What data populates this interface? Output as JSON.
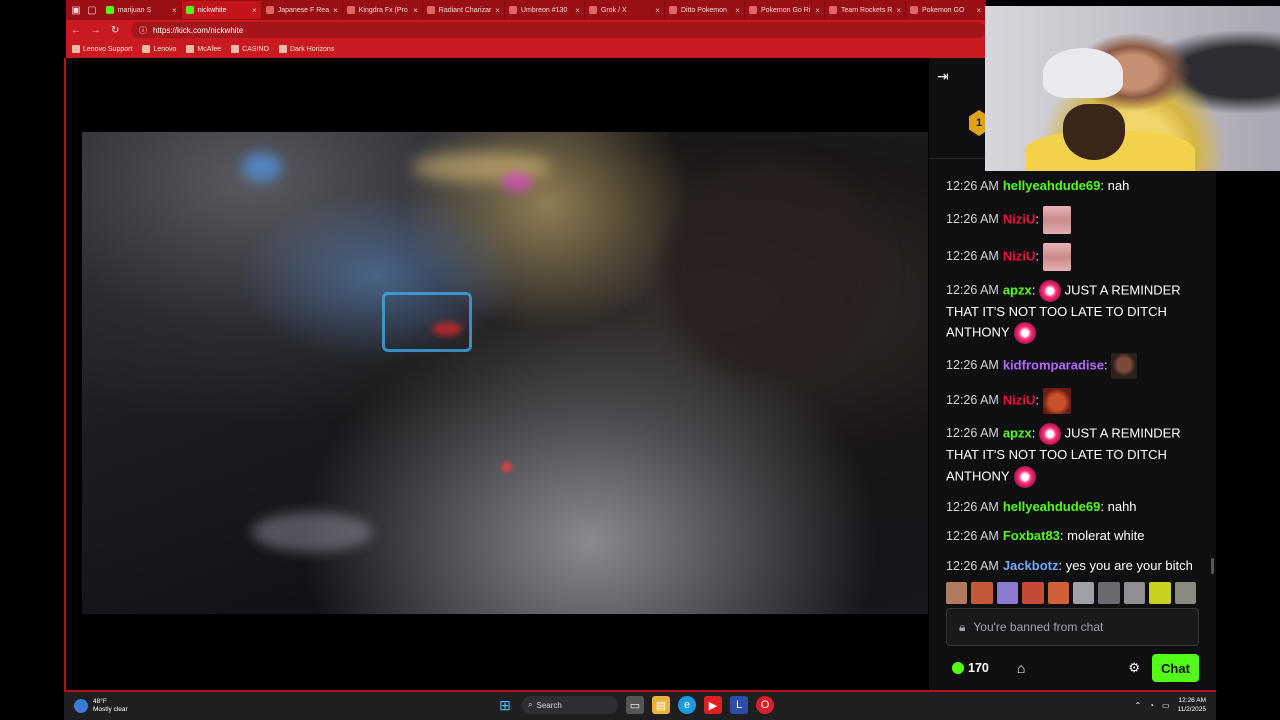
{
  "browser": {
    "tabs": [
      {
        "label": "marijuan S",
        "active": false
      },
      {
        "label": "nickwhite",
        "active": true
      },
      {
        "label": "Japanese F Rea",
        "active": false
      },
      {
        "label": "Kingdra Fx (Pro",
        "active": false
      },
      {
        "label": "Radiant Charizar",
        "active": false
      },
      {
        "label": "Umbreon #130",
        "active": false
      },
      {
        "label": "Grok / X",
        "active": false
      },
      {
        "label": "Ditto Pokemon",
        "active": false
      },
      {
        "label": "Pokemon Go Ri",
        "active": false
      },
      {
        "label": "Team Rockets R",
        "active": false
      },
      {
        "label": "Pokemon GO",
        "active": false
      }
    ],
    "url": "https://kick.com/nickwhite",
    "bookmarks": [
      "Lenovo Support",
      "Lenovo",
      "McAfee",
      "CASINO",
      "Dark Horizons"
    ]
  },
  "chat": {
    "badge": "1",
    "messages": [
      {
        "time": "12:26 AM",
        "user": "hellyeahdude69",
        "color": "#53fc18",
        "text": "nah",
        "emotes": []
      },
      {
        "time": "12:26 AM",
        "user": "NiziU",
        "color": "#e9113c",
        "text": "",
        "emotes": [
          "pink"
        ]
      },
      {
        "time": "12:26 AM",
        "user": "NiziU",
        "color": "#e9113c",
        "text": "",
        "emotes": [
          "pink"
        ]
      },
      {
        "time": "12:26 AM",
        "user": "apzx",
        "color": "#53fc18",
        "text": "JUST A REMINDER THAT IT'S NOT TOO LATE TO DITCH ANTHONY",
        "emotes": [
          "ring"
        ]
      },
      {
        "time": "12:26 AM",
        "user": "kidfromparadise",
        "color": "#b467ff",
        "text": "",
        "emotes": [
          "face"
        ]
      },
      {
        "time": "12:26 AM",
        "user": "NiziU",
        "color": "#e9113c",
        "text": "",
        "emotes": [
          "red"
        ]
      },
      {
        "time": "12:26 AM",
        "user": "apzx",
        "color": "#53fc18",
        "text": "JUST A REMINDER THAT IT'S NOT TOO LATE TO DITCH ANTHONY",
        "emotes": [
          "ring"
        ]
      },
      {
        "time": "12:26 AM",
        "user": "hellyeahdude69",
        "color": "#53fc18",
        "text": "nahh",
        "emotes": []
      },
      {
        "time": "12:26 AM",
        "user": "Foxbat83",
        "color": "#53fc18",
        "text": "molerat white",
        "emotes": []
      },
      {
        "time": "12:26 AM",
        "user": "Jackbotz",
        "color": "#75a7f5",
        "text": "yes you are your bitch",
        "emotes": []
      }
    ],
    "input_placeholder": "You're banned from chat",
    "points": "170",
    "chat_button": "Chat"
  },
  "taskbar": {
    "weather_temp": "48°F",
    "weather_desc": "Mostly clear",
    "search_placeholder": "Search",
    "time": "12:26 AM",
    "date": "11/2/2025"
  },
  "colors": {
    "browser_red": "#c81a20",
    "kick_green": "#53fc18"
  }
}
